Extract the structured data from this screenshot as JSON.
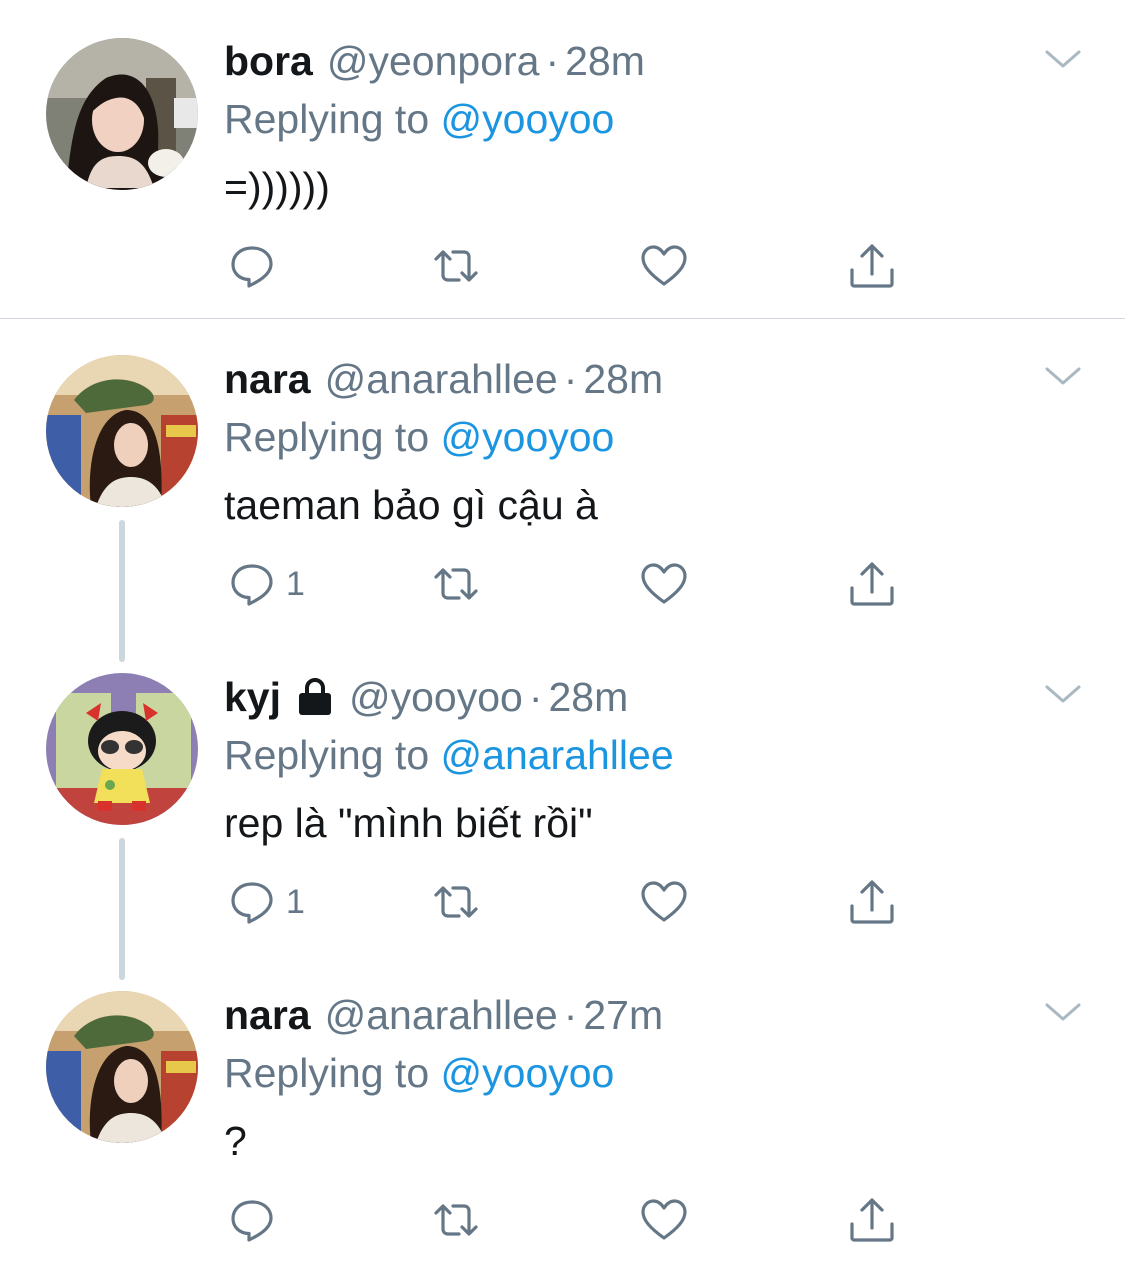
{
  "tweets": [
    {
      "name": "bora",
      "locked": false,
      "handle": "@yeonpora",
      "separator": "·",
      "time": "28m",
      "replying_prefix": "Replying to ",
      "replying_to": "@yooyoo",
      "text": "=))))))",
      "reply_count": ""
    },
    {
      "name": "nara",
      "locked": false,
      "handle": "@anarahllee",
      "separator": "·",
      "time": "28m",
      "replying_prefix": "Replying to ",
      "replying_to": "@yooyoo",
      "text": "taeman bảo gì cậu à",
      "reply_count": "1"
    },
    {
      "name": "kyj",
      "locked": true,
      "handle": "@yooyoo",
      "separator": "·",
      "time": "28m",
      "replying_prefix": "Replying to ",
      "replying_to": "@anarahllee",
      "text": "rep là \"mình biết rồi\"",
      "reply_count": "1"
    },
    {
      "name": "nara",
      "locked": false,
      "handle": "@anarahllee",
      "separator": "·",
      "time": "27m",
      "replying_prefix": "Replying to ",
      "replying_to": "@yooyoo",
      "text": "?",
      "reply_count": ""
    }
  ],
  "icons": {
    "reply": "reply-icon",
    "retweet": "retweet-icon",
    "like": "heart-icon",
    "share": "share-icon",
    "menu": "chevron-down-icon",
    "locked": "lock-icon"
  },
  "colors": {
    "text": "#14171a",
    "secondary": "#657786",
    "mention": "#1b95e0",
    "thread_line": "#ccd6dd"
  }
}
